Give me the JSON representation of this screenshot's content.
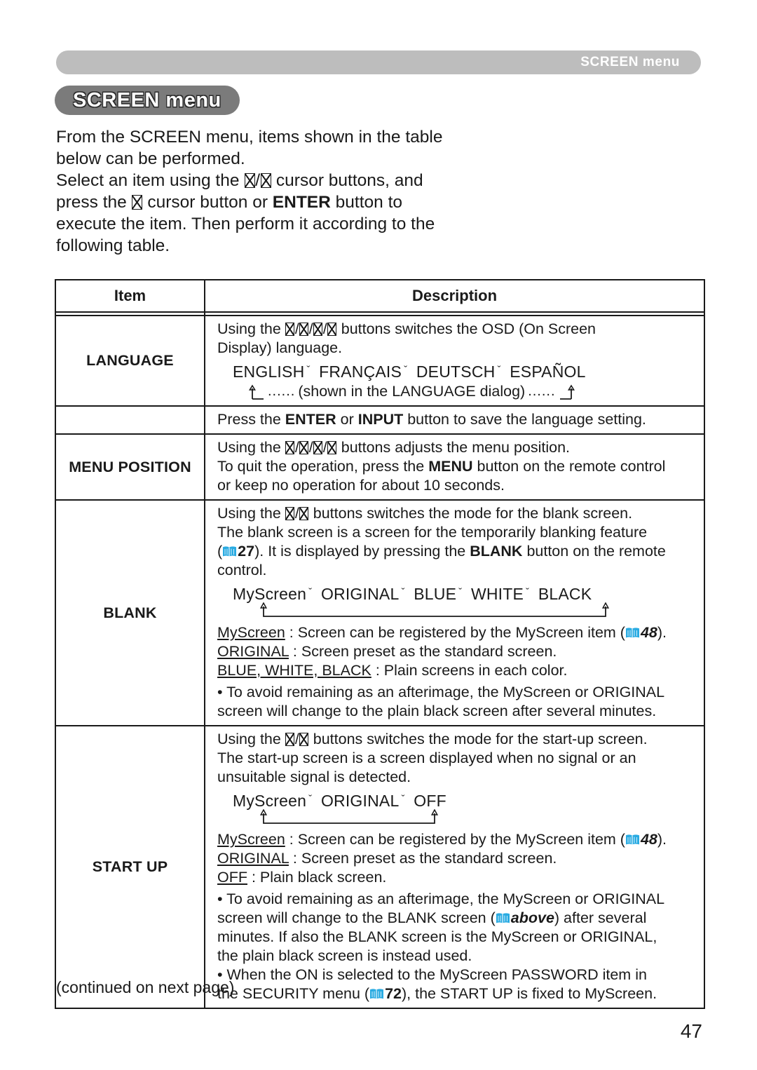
{
  "header": {
    "running_head": "SCREEN menu"
  },
  "title": {
    "label": "SCREEN menu"
  },
  "intro": {
    "line1": "From the SCREEN menu, items shown in the table",
    "line2": "below can be performed.",
    "line3_a": "Select an item using the ",
    "line3_b": " cursor buttons, and",
    "line4_a": "press the ",
    "line4_b": " cursor button or ",
    "line4_bold": "ENTER",
    "line4_c": " button to",
    "line5": "execute the item. Then perform it according to the",
    "line6": "following table."
  },
  "table": {
    "headers": {
      "item": "Item",
      "description": "Description"
    },
    "rows": [
      {
        "item": "LANGUAGE",
        "desc": {
          "l1_a": "Using the ",
          "l1_b": " buttons switches the OSD (On Screen",
          "l2": "Display) language.",
          "options": [
            "ENGLISH",
            "FRANÇAIS",
            "DEUTSCH",
            "ESPAÑOL"
          ],
          "loop_note": "(shown in the LANGUAGE dialog)",
          "loop_dots_left": "......",
          "loop_dots_right": "......",
          "footer_a": "Press the ",
          "footer_b1": "ENTER",
          "footer_c": " or ",
          "footer_b2": "INPUT",
          "footer_d": " button to save the language setting."
        }
      },
      {
        "item": "MENU POSITION",
        "desc": {
          "l1_a": "Using the ",
          "l1_b": " buttons adjusts the menu position.",
          "l2_a": "To quit the operation, press the ",
          "l2_bold": "MENU",
          "l2_b": " button on the remote control",
          "l3": "or keep no operation for about 10 seconds."
        }
      },
      {
        "item": "BLANK",
        "desc": {
          "l1_a": "Using the ",
          "l1_b": " buttons switches the mode for the blank screen.",
          "l2": "The blank screen is a screen for the temporarily blanking feature",
          "l3_a": "(",
          "l3_page": "27",
          "l3_b": "). It is displayed by pressing the ",
          "l3_bold": "BLANK",
          "l3_c": " button on the remote",
          "l4": "control.",
          "options": [
            "MyScreen",
            "ORIGINAL",
            "BLUE",
            "WHITE",
            "BLACK"
          ],
          "def1_term": "MyScreen",
          "def1_text_a": " : Screen can be registered by the MyScreen item (",
          "def1_page": "48",
          "def1_text_b": ").",
          "def2_term": "ORIGINAL",
          "def2_text": " : Screen preset as the standard screen.",
          "def3_term": "BLUE, WHITE, BLACK",
          "def3_text": " : Plain screens in each color.",
          "bullet1_l1": "• To avoid remaining as an afterimage, the MyScreen or ORIGINAL",
          "bullet1_l2": "screen will change to the plain black screen after several minutes."
        }
      },
      {
        "item": "START UP",
        "desc": {
          "l1_a": "Using the ",
          "l1_b": " buttons switches the mode for the start-up screen.",
          "l2": "The start-up screen is a screen displayed when no signal or an",
          "l3": "unsuitable signal is detected.",
          "options": [
            "MyScreen",
            "ORIGINAL",
            "OFF"
          ],
          "def1_term": "MyScreen",
          "def1_text_a": " : Screen can be registered by the MyScreen item (",
          "def1_page": "48",
          "def1_text_b": ").",
          "def2_term": "ORIGINAL",
          "def2_text": " : Screen preset as the standard screen.",
          "def3_term": "OFF",
          "def3_text": " : Plain black screen.",
          "bullet1_l1": "• To avoid remaining as an afterimage, the MyScreen or ORIGINAL",
          "bullet1_l2_a": "screen will change to the BLANK screen (",
          "bullet1_ref": "above",
          "bullet1_l2_b": ") after several",
          "bullet1_l3": "minutes. If also the BLANK screen is the MyScreen or ORIGINAL,",
          "bullet1_l4": "the plain black screen is instead used.",
          "bullet2_l1": "• When the ON is selected to the MyScreen PASSWORD item in",
          "bullet2_l2_a": "the SECURITY menu (",
          "bullet2_page": "72",
          "bullet2_l2_b": "), the START UP is fixed to MyScreen."
        }
      }
    ]
  },
  "footer": {
    "continued": "(continued on next page)",
    "page_number": "47"
  },
  "colors": {
    "header_bar": "#bdbdbd",
    "title_pill": "#7b7b7b",
    "book_icon": "#29ABE2",
    "text": "#1a1a1a"
  }
}
